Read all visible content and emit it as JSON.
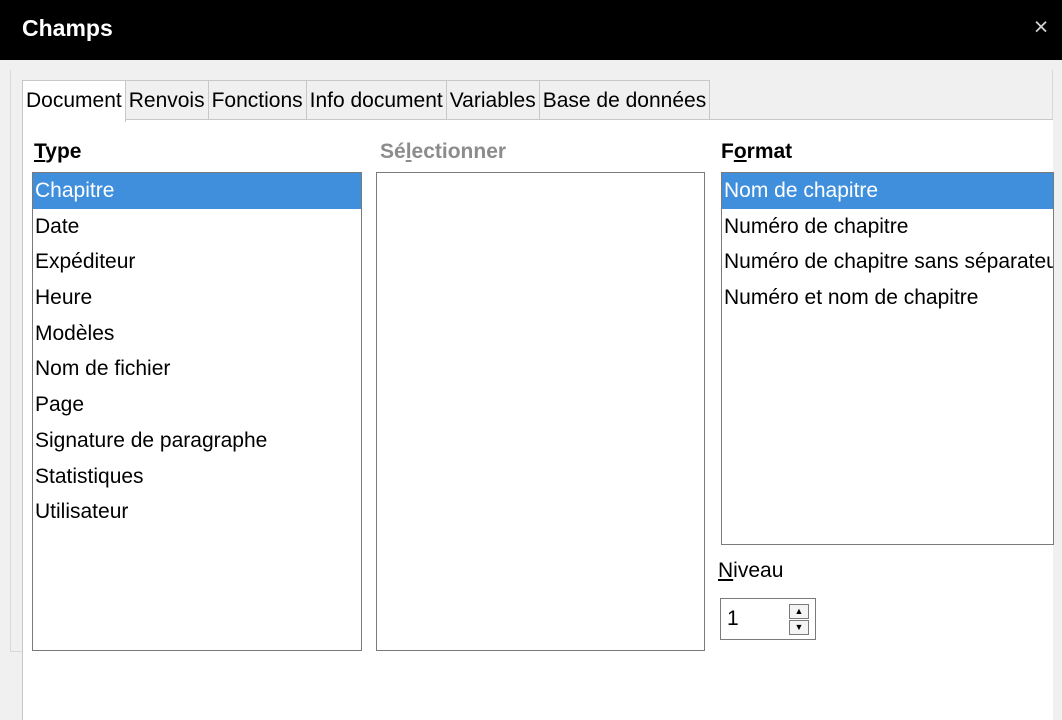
{
  "window": {
    "title": "Champs",
    "close_glyph": "×"
  },
  "tabs": [
    {
      "label": "Document",
      "active": true
    },
    {
      "label": "Renvois"
    },
    {
      "label": "Fonctions"
    },
    {
      "label": "Info document"
    },
    {
      "label": "Variables"
    },
    {
      "label": "Base de données"
    }
  ],
  "type": {
    "heading_accel": "T",
    "heading_rest": "ype",
    "items": [
      "Chapitre",
      "Date",
      "Expéditeur",
      "Heure",
      "Modèles",
      "Nom de fichier",
      "Page",
      "Signature de paragraphe",
      "Statistiques",
      "Utilisateur"
    ],
    "selected": "Chapitre"
  },
  "select": {
    "heading_pre": "Sé",
    "heading_accel": "l",
    "heading_post": "ectionner"
  },
  "format": {
    "heading_pre": "F",
    "heading_accel": "o",
    "heading_post": "rmat",
    "items": [
      "Nom de chapitre",
      "Numéro de chapitre",
      "Numéro de chapitre sans séparateur",
      "Numéro et nom de chapitre"
    ],
    "selected": "Nom de chapitre"
  },
  "niveau": {
    "label_accel": "N",
    "label_rest": "iveau",
    "value": "1",
    "up_glyph": "▲",
    "down_glyph": "▼"
  }
}
